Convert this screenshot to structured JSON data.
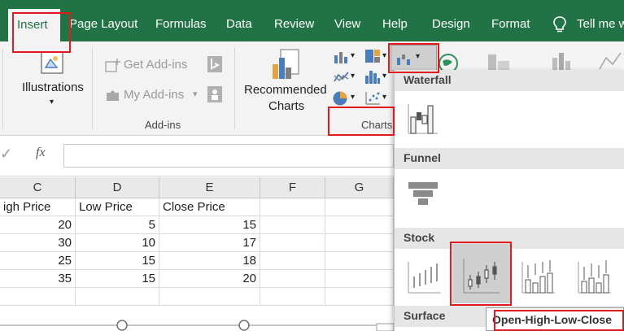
{
  "ribbon_tabs": [
    "Insert",
    "Page Layout",
    "Formulas",
    "Data",
    "Review",
    "View",
    "Help",
    "Design",
    "Format"
  ],
  "tell_me": "Tell me w",
  "illustrations": {
    "label": "Illustrations"
  },
  "addins": {
    "get": "Get Add-ins",
    "my": "My Add-ins",
    "group_label": "Add-ins"
  },
  "recommended": {
    "line1": "Recommended",
    "line2": "Charts"
  },
  "charts_group_label": "Charts",
  "formula_bar": {
    "fx": "fx",
    "check": "✓"
  },
  "columns": [
    "C",
    "D",
    "E",
    "F",
    "G"
  ],
  "rows": [
    [
      "igh Price",
      "Low Price",
      "Close Price",
      "",
      ""
    ],
    [
      "20",
      "5",
      "15",
      "",
      ""
    ],
    [
      "30",
      "10",
      "17",
      "",
      ""
    ],
    [
      "25",
      "15",
      "18",
      "",
      ""
    ],
    [
      "35",
      "15",
      "20",
      "",
      ""
    ]
  ],
  "chart_panel": {
    "sections": [
      "Waterfall",
      "Funnel",
      "Stock",
      "Surface"
    ],
    "tooltip": "Open-High-Low-Close"
  },
  "colors": {
    "excel_green": "#217346",
    "highlight_red": "#e01b1b"
  }
}
